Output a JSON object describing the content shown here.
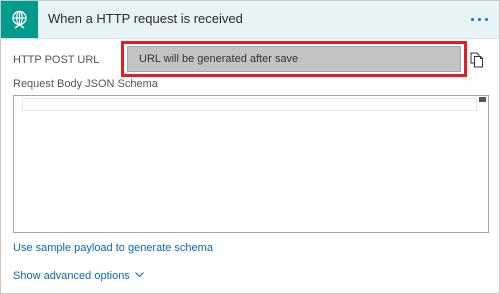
{
  "card": {
    "title": "When a HTTP request is received",
    "icon": "globe-request-icon",
    "menu_icon": "ellipsis-icon"
  },
  "fields": {
    "http_post_url": {
      "label": "HTTP POST URL",
      "value": "URL will be generated after save",
      "copy_icon": "copy-icon"
    },
    "request_body_schema": {
      "label": "Request Body JSON Schema",
      "value": ""
    }
  },
  "links": {
    "sample_payload": "Use sample payload to generate schema",
    "advanced_options": "Show advanced options",
    "advanced_icon": "chevron-down-icon"
  },
  "colors": {
    "header_bg": "#e7f3f5",
    "icon_bg": "#009b8c",
    "link": "#0a6ab6",
    "highlight": "#e02020",
    "url_field_bg": "#c3c3c3"
  }
}
